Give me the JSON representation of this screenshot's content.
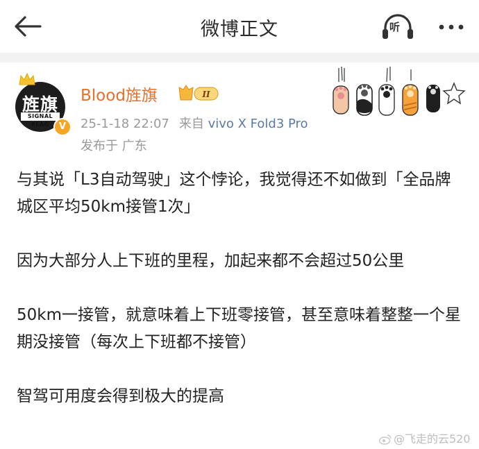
{
  "navbar": {
    "title": "微博正文",
    "listen_label": "听",
    "icons": [
      "back-arrow-icon",
      "headphones-icon",
      "more-icon"
    ]
  },
  "post": {
    "author": "Blood旌旗",
    "avatar_text": "旌旗",
    "avatar_subtext": "SIGNAL FLAG",
    "rank_badge": "II",
    "timestamp": "25-1-18 22:07",
    "from_label": "来自",
    "device": "vivo X Fold3 Pro",
    "location": "发布于 广东",
    "paragraphs": [
      "与其说「L3自动驾驶」这个悖论，我觉得还不如做到「全品牌城区平均50km接管1次」",
      "因为大部分人上下班的里程，加起来都不会超过50公里",
      "50km一接管，就意味着上下班零接管，甚至意味着整整一个星期没接管（每次上下班都不接管）",
      "智驾可用度会得到极大的提高"
    ]
  },
  "watermark": "@飞走的云520",
  "colors": {
    "username": "#e8702a",
    "device": "#5a7aa6",
    "meta": "#999999",
    "verified": "#f5a623"
  }
}
